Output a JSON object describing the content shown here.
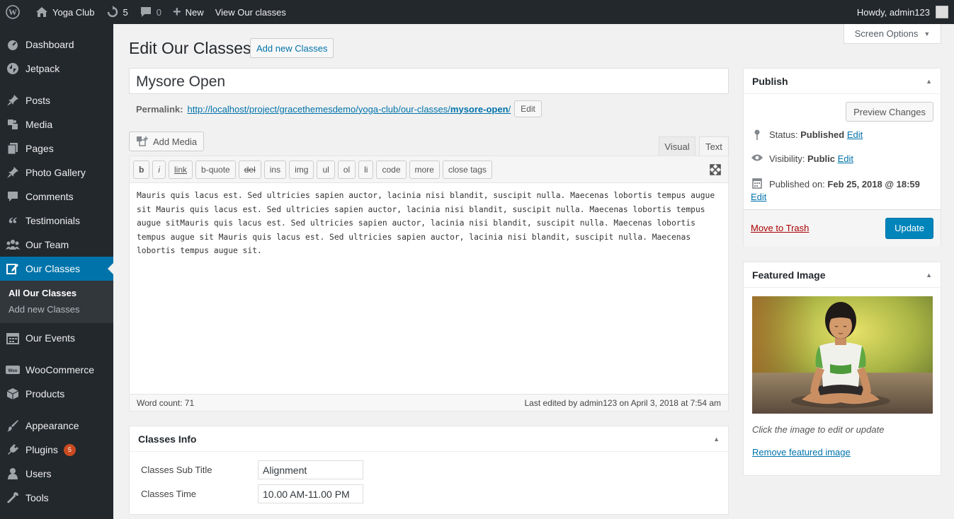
{
  "adminbar": {
    "site_name": "Yoga Club",
    "updates_count": "5",
    "comments_count": "0",
    "new_label": "New",
    "view_label": "View Our classes",
    "howdy": "Howdy, admin123"
  },
  "sidebar": {
    "items": [
      {
        "label": "Dashboard",
        "icon": "dashboard-icon"
      },
      {
        "label": "Jetpack",
        "icon": "jetpack-icon"
      },
      {
        "label": "Posts",
        "icon": "pin-icon"
      },
      {
        "label": "Media",
        "icon": "media-icon"
      },
      {
        "label": "Pages",
        "icon": "pages-icon"
      },
      {
        "label": "Photo Gallery",
        "icon": "pin-icon"
      },
      {
        "label": "Comments",
        "icon": "comment-icon"
      },
      {
        "label": "Testimonials",
        "icon": "quote-icon"
      },
      {
        "label": "Our Team",
        "icon": "team-icon"
      },
      {
        "label": "Our Classes",
        "icon": "edit-icon"
      },
      {
        "label": "Our Events",
        "icon": "calendar-icon"
      },
      {
        "label": "WooCommerce",
        "icon": "woo-icon"
      },
      {
        "label": "Products",
        "icon": "box-icon"
      },
      {
        "label": "Appearance",
        "icon": "brush-icon"
      },
      {
        "label": "Plugins",
        "icon": "plug-icon",
        "badge": "5"
      },
      {
        "label": "Users",
        "icon": "user-icon"
      },
      {
        "label": "Tools",
        "icon": "wrench-icon"
      }
    ],
    "submenu": [
      "All Our Classes",
      "Add new Classes"
    ]
  },
  "screen_options": "Screen Options",
  "page_title": "Edit Our Classes",
  "add_new_label": "Add new Classes",
  "post_title": "Mysore Open",
  "permalink": {
    "label": "Permalink:",
    "url_base": "http://localhost/project/gracethemesdemo/yoga-club/our-classes/",
    "slug": "mysore-open",
    "trailing": "/",
    "edit_label": "Edit"
  },
  "add_media_label": "Add Media",
  "tabs": {
    "visual": "Visual",
    "text": "Text"
  },
  "quicktags": [
    "b",
    "i",
    "link",
    "b-quote",
    "del",
    "ins",
    "img",
    "ul",
    "ol",
    "li",
    "code",
    "more",
    "close tags"
  ],
  "content": "Mauris quis lacus est. Sed ultricies sapien auctor, lacinia nisi blandit, suscipit nulla. Maecenas lobortis tempus augue sit Mauris quis lacus est. Sed ultricies sapien auctor, lacinia nisi blandit, suscipit nulla. Maecenas lobortis tempus augue sitMauris quis lacus est. Sed ultricies sapien auctor, lacinia nisi blandit, suscipit nulla. Maecenas lobortis tempus augue sit Mauris quis lacus est. Sed ultricies sapien auctor, lacinia nisi blandit, suscipit nulla. Maecenas lobortis tempus augue sit.",
  "word_count": "Word count: 71",
  "last_edited": "Last edited by admin123 on April 3, 2018 at 7:54 am",
  "classes_info": {
    "title": "Classes Info",
    "sub_title_label": "Classes Sub Title",
    "sub_title_value": "Alignment",
    "time_label": "Classes Time",
    "time_value": "10.00 AM-11.00 PM"
  },
  "publish": {
    "title": "Publish",
    "preview_label": "Preview Changes",
    "status_label": "Status:",
    "status_value": "Published",
    "visibility_label": "Visibility:",
    "visibility_value": "Public",
    "published_label": "Published on:",
    "published_value": "Feb 25, 2018 @ 18:59",
    "edit_label": "Edit",
    "trash_label": "Move to Trash",
    "update_label": "Update"
  },
  "featured": {
    "title": "Featured Image",
    "help": "Click the image to edit or update",
    "remove_label": "Remove featured image"
  },
  "colors": {
    "sidebar_bg": "#23282d",
    "active_blue": "#0073aa",
    "update_blue": "#0085ba",
    "trash_red": "#a00"
  }
}
